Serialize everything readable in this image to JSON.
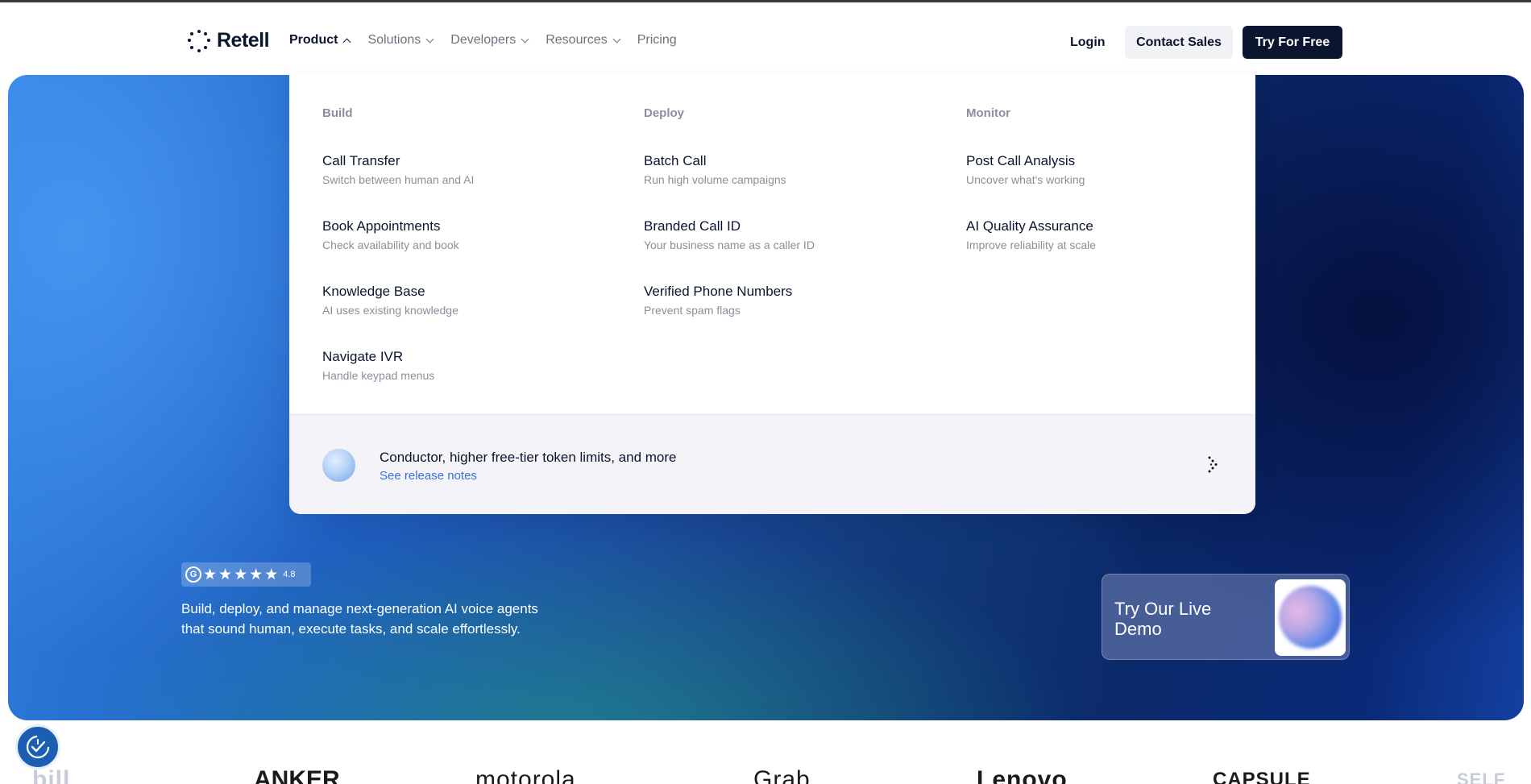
{
  "header": {
    "logo_text": "Retell",
    "nav": [
      {
        "label": "Product"
      },
      {
        "label": "Solutions"
      },
      {
        "label": "Developers"
      },
      {
        "label": "Resources"
      },
      {
        "label": "Pricing"
      }
    ],
    "login_label": "Login",
    "contact_label": "Contact Sales",
    "try_label": "Try For Free"
  },
  "dropdown": {
    "columns": [
      {
        "title": "Build",
        "items": [
          {
            "title": "Call Transfer",
            "desc": "Switch between human and AI"
          },
          {
            "title": "Book Appointments",
            "desc": "Check availability and book"
          },
          {
            "title": "Knowledge Base",
            "desc": "AI uses existing knowledge"
          },
          {
            "title": "Navigate IVR",
            "desc": "Handle keypad menus"
          }
        ]
      },
      {
        "title": "Deploy",
        "items": [
          {
            "title": "Batch Call",
            "desc": "Run high volume campaigns"
          },
          {
            "title": "Branded Call ID",
            "desc": "Your business name as a caller ID"
          },
          {
            "title": "Verified Phone Numbers",
            "desc": "Prevent spam flags"
          }
        ]
      },
      {
        "title": "Monitor",
        "items": [
          {
            "title": "Post Call Analysis",
            "desc": "Uncover what's working"
          },
          {
            "title": "AI Quality Assurance",
            "desc": "Improve reliability at scale"
          }
        ]
      }
    ],
    "footer": {
      "title": "Conductor, higher free-tier token limits, and more",
      "link": "See release notes"
    }
  },
  "hero": {
    "rating_badge": "G",
    "rating": 4.8,
    "rating_text": "4.8",
    "stars": [
      "★",
      "★",
      "★",
      "★",
      "★"
    ],
    "description": "Build, deploy, and manage next-generation AI voice agents that sound human, execute tasks, and scale effortlessly.",
    "demo_label": "Try Our Live Demo"
  },
  "logos": [
    "bill",
    "ANKER",
    "motorola",
    "Grab",
    "Lenovo",
    "CAPSULE",
    "SELF"
  ],
  "colors": {
    "brand_dark": "#0b1530",
    "link": "#3b6fe0",
    "muted": "#8a8f9c"
  }
}
